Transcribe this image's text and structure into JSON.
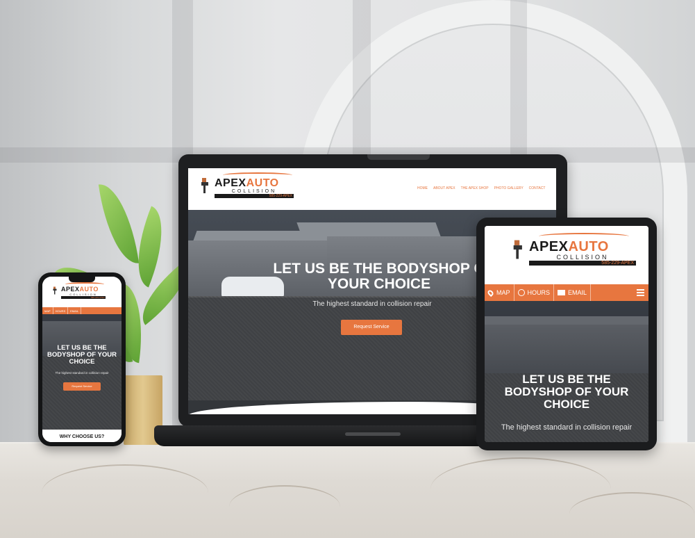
{
  "brand": {
    "name_primary": "APEX",
    "name_accent": "AUTO",
    "name_sub": "COLLISION",
    "phone": "585-229-APEX"
  },
  "nav": {
    "items": [
      "HOME",
      "ABOUT APEX",
      "THE APEX SHOP",
      "PHOTO GALLERY",
      "CONTACT"
    ]
  },
  "hero": {
    "laptop_title_line1": "LET US BE THE BODYSHOP O",
    "laptop_title_line2": "YOUR CHOICE",
    "tablet_title": "LET US BE THE BODYSHOP OF YOUR CHOICE",
    "phone_title": "LET US BE THE BODYSHOP OF YOUR CHOICE",
    "subtitle": "The highest standard in collision repair",
    "cta_label": "Request Service"
  },
  "mobile_bar": {
    "map_label": "MAP",
    "hours_label": "HOURS",
    "email_label": "EMAIL"
  },
  "phone_section": {
    "heading": "WHY CHOOSE US?"
  },
  "colors": {
    "accent": "#e7763f",
    "dark": "#1a1a1a"
  }
}
